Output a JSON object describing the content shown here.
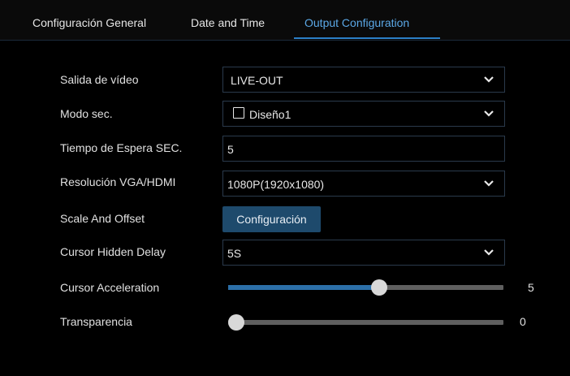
{
  "tabs": [
    {
      "label": "Configuración General",
      "active": false
    },
    {
      "label": "Date and Time",
      "active": false
    },
    {
      "label": "Output Configuration",
      "active": true
    }
  ],
  "settings": {
    "video_output": {
      "label": "Salida de vídeo",
      "value": "LIVE-OUT"
    },
    "seq_mode": {
      "label": "Modo sec.",
      "value": "Diseño1",
      "checked": false
    },
    "seq_timeout": {
      "label": "Tiempo de Espera SEC.",
      "value": "5"
    },
    "resolution": {
      "label": "Resolución VGA/HDMI",
      "value": "1080P(1920x1080)"
    },
    "scale_offset": {
      "label": "Scale And Offset",
      "button_label": "Configuración"
    },
    "cursor_hidden_delay": {
      "label": "Cursor Hidden Delay",
      "value": "5S"
    },
    "cursor_acceleration": {
      "label": "Cursor Acceleration",
      "value": "5",
      "fraction": 0.55
    },
    "transparency": {
      "label": "Transparencia",
      "value": "0",
      "fraction": 0.0
    }
  },
  "colors": {
    "accent": "#5ba8e6",
    "button_bg": "#1e4a6c",
    "slider_fill": "#2c6fa8",
    "field_border": "#2a3a4c"
  },
  "icons": {
    "dropdown": "chevron-down-icon",
    "checkbox": "checkbox-icon"
  }
}
